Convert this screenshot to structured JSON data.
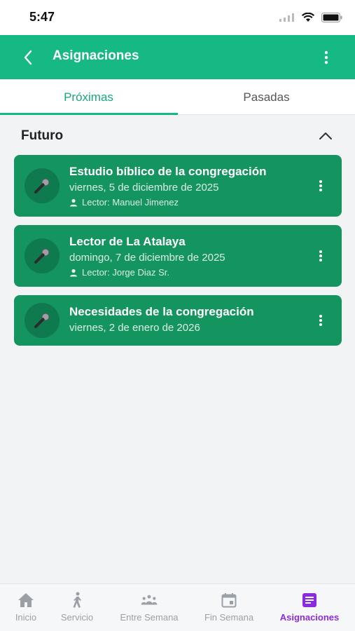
{
  "status_bar": {
    "time": "5:47"
  },
  "app_bar": {
    "title": "Asignaciones",
    "back_icon": "chevron-left-icon",
    "menu_icon": "more-vertical-icon"
  },
  "tabs": [
    {
      "label": "Próximas",
      "active": true
    },
    {
      "label": "Pasadas",
      "active": false
    }
  ],
  "section": {
    "title": "Futuro",
    "collapse_icon": "chevron-up-icon"
  },
  "assignments": [
    {
      "title": "Estudio bíblico de la congregación",
      "date": "viernes, 5 de diciembre de 2025",
      "role": "Lector: Manuel Jimenez",
      "icon": "microphone-icon"
    },
    {
      "title": "Lector de La Atalaya",
      "date": "domingo, 7 de diciembre de 2025",
      "role": "Lector: Jorge Diaz Sr.",
      "icon": "microphone-icon"
    },
    {
      "title": "Necesidades de la congregación",
      "date": "viernes, 2 de enero de 2026",
      "role": "",
      "icon": "microphone-icon"
    }
  ],
  "bottom_nav": [
    {
      "label": "Inicio",
      "icon": "home-icon",
      "active": false
    },
    {
      "label": "Servicio",
      "icon": "walking-person-icon",
      "active": false
    },
    {
      "label": "Entre Semana",
      "icon": "group-icon",
      "active": false
    },
    {
      "label": "Fin Semana",
      "icon": "calendar-icon",
      "active": false
    },
    {
      "label": "Asignaciones",
      "icon": "assignment-icon",
      "active": true
    }
  ],
  "colors": {
    "primary": "#16b884",
    "card": "#14945f",
    "active_nav": "#8a2be2"
  }
}
